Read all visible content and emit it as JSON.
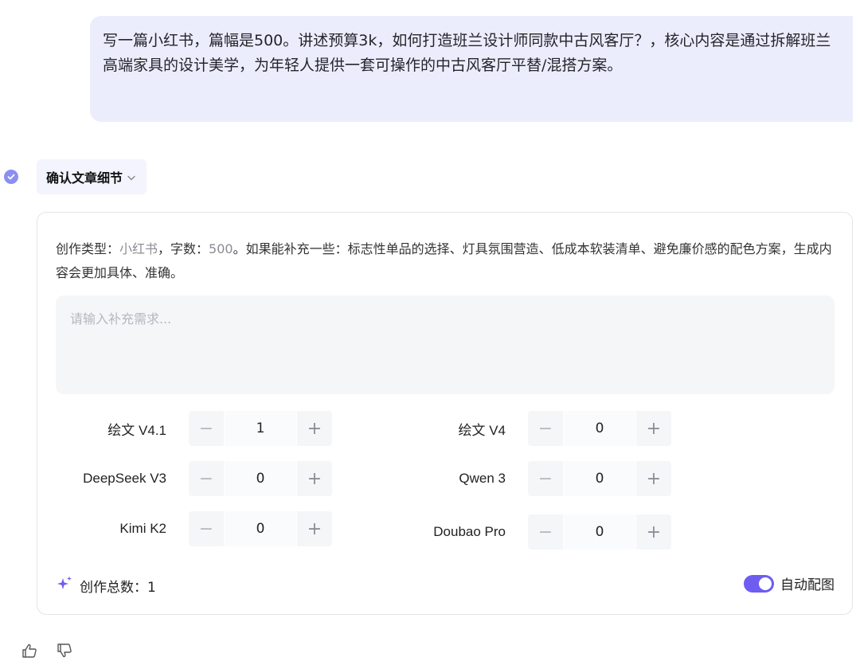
{
  "user_message": "写一篇小红书，篇幅是500。讲述预算3k，如何打造班兰设计师同款中古风客厅？，核心内容是通过拆解班兰高端家具的设计美学，为年轻人提供一套可操作的中古风客厅平替/混搭方案。",
  "step": {
    "label": "确认文章细节",
    "check_icon": "check-circle-icon",
    "toggle_icon": "chevron-down-icon"
  },
  "card": {
    "desc_prefix": "创作类型：",
    "type_value": "小红书",
    "desc_sep": "，字数：",
    "words_value": "500",
    "desc_suffix": "。如果能补充一些：标志性单品的选择、灯具氛围营造、低成本软装清单、避免廉价感的配色方案，生成内容会更加具体、准确。",
    "input_placeholder": "请输入补充需求...",
    "input_value": "",
    "models": [
      {
        "name": "绘文 V4.1",
        "count": "1"
      },
      {
        "name": "绘文 V4",
        "count": "0"
      },
      {
        "name": "DeepSeek V3",
        "count": "0"
      },
      {
        "name": "Qwen 3",
        "count": "0"
      },
      {
        "name": "Kimi K2",
        "count": "0"
      },
      {
        "name": "Doubao Pro",
        "count": "0"
      }
    ],
    "minus_symbol": "−",
    "plus_symbol": "+",
    "total_label": "创作总数：",
    "total_value": "1",
    "auto_image_label": "自动配图",
    "auto_image_on": true
  },
  "colors": {
    "accent": "#6f5cf0",
    "bubble": "#ecedfc",
    "check": "#8b8ff0"
  }
}
